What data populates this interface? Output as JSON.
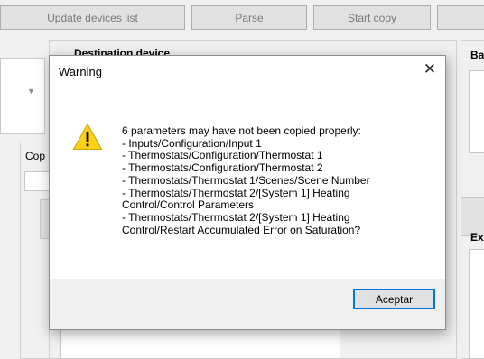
{
  "toolbar": {
    "update_devices_label": "Update devices list",
    "parse_label": "Parse",
    "start_copy_label": "Start copy"
  },
  "destination": {
    "heading": "Destination device"
  },
  "right_panel": {
    "heading_top": "Ba",
    "heading_bottom": "Ex"
  },
  "copy_panel": {
    "label": "Cop"
  },
  "dialog": {
    "title": "Warning",
    "close_glyph": "✕",
    "icon": "warning-icon",
    "message_lines": [
      "6  parameters may have not been copied properly:",
      "- Inputs/Configuration/Input 1",
      "- Thermostats/Configuration/Thermostat 1",
      "- Thermostats/Configuration/Thermostat 2",
      "- Thermostats/Thermostat 1/Scenes/Scene Number",
      "- Thermostats/Thermostat 2/[System 1] Heating",
      "Control/Control Parameters",
      "- Thermostats/Thermostat 2/[System 1] Heating",
      "Control/Restart Accumulated Error on Saturation?"
    ],
    "ok_label": "Aceptar"
  },
  "colors": {
    "accent": "#0078d7",
    "warning_fill": "#fcd116",
    "dialog_footer": "#f0f0f0"
  }
}
